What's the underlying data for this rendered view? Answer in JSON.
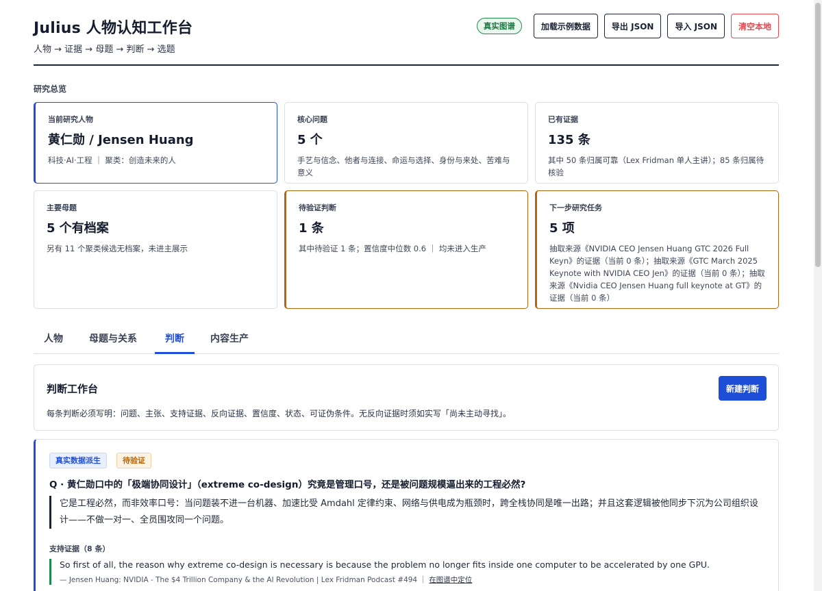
{
  "header": {
    "title": "Julius 人物认知工作台",
    "breadcrumb": "人物 → 证据 → 母题 → 判断 → 选题",
    "badge": "真实图谱",
    "buttons": {
      "load_sample": "加载示例数据",
      "export": "导出 JSON",
      "import": "导入 JSON",
      "clear": "清空本地"
    }
  },
  "overview": {
    "label": "研究总览",
    "cards": [
      {
        "label": "当前研究人物",
        "value": "黄仁勋 / Jensen Huang",
        "desc": "科技·AI·工程 ｜ 聚类：创造未来的人"
      },
      {
        "label": "核心问题",
        "value": "5 个",
        "desc": "手艺与信念、他者与连接、命运与选择、身份与来处、苦难与意义"
      },
      {
        "label": "已有证据",
        "value": "135 条",
        "desc": "其中 50 条归属可靠（Lex Fridman 单人主讲）；85 条归属待核验"
      },
      {
        "label": "主要母题",
        "value": "5 个有档案",
        "desc": "另有 11 个聚类候选无档案，未进主展示"
      },
      {
        "label": "待验证判断",
        "value": "1 条",
        "desc": "其中待验证 1 条；置信度中位数 0.6 ｜ 均未进入生产"
      },
      {
        "label": "下一步研究任务",
        "value": "5 项",
        "desc": "抽取来源《NVIDIA CEO Jensen Huang GTC 2026 Full Keyn》的证据（当前 0 条）；抽取来源《GTC March 2025 Keynote with NVIDIA CEO Jen》的证据（当前 0 条）；抽取来源《Nvidia CEO Jensen Huang full keynote at GT》的证据（当前 0 条）"
      }
    ]
  },
  "tabs": [
    "人物",
    "母题与关系",
    "判断",
    "内容生产"
  ],
  "workbench": {
    "title": "判断工作台",
    "new_button": "新建判断",
    "desc": "每条判断必须写明：问题、主张、支持证据、反向证据、置信度、状态、可证伪条件。无反向证据时须如实写「尚未主动寻找」。"
  },
  "judgment": {
    "badge_source": "真实数据派生",
    "badge_status": "待验证",
    "question": "Q · 黄仁勋口中的「极端协同设计」（extreme co-design）究竟是管理口号，还是被问题规模逼出来的工程必然?",
    "claim": "它是工程必然，而非效率口号：当问题装不进一台机器、加速比受 Amdahl 定律约束、网络与供电成为瓶颈时，跨全栈协同是唯一出路；并且这套逻辑被他同步下沉为公司组织设计——不做一对一、全员围攻同一个问题。",
    "support_label": "支持证据（8 条）",
    "evidence": {
      "quote": "So first of all, the reason why extreme co-design is necessary is because the problem no longer fits inside one computer to be accelerated by one GPU.",
      "source": "— Jensen Huang: NVIDIA - The $4 Trillion Company & the AI Revolution | Lex Fridman Podcast #494",
      "separator": "｜",
      "link": "在图谱中定位"
    }
  }
}
